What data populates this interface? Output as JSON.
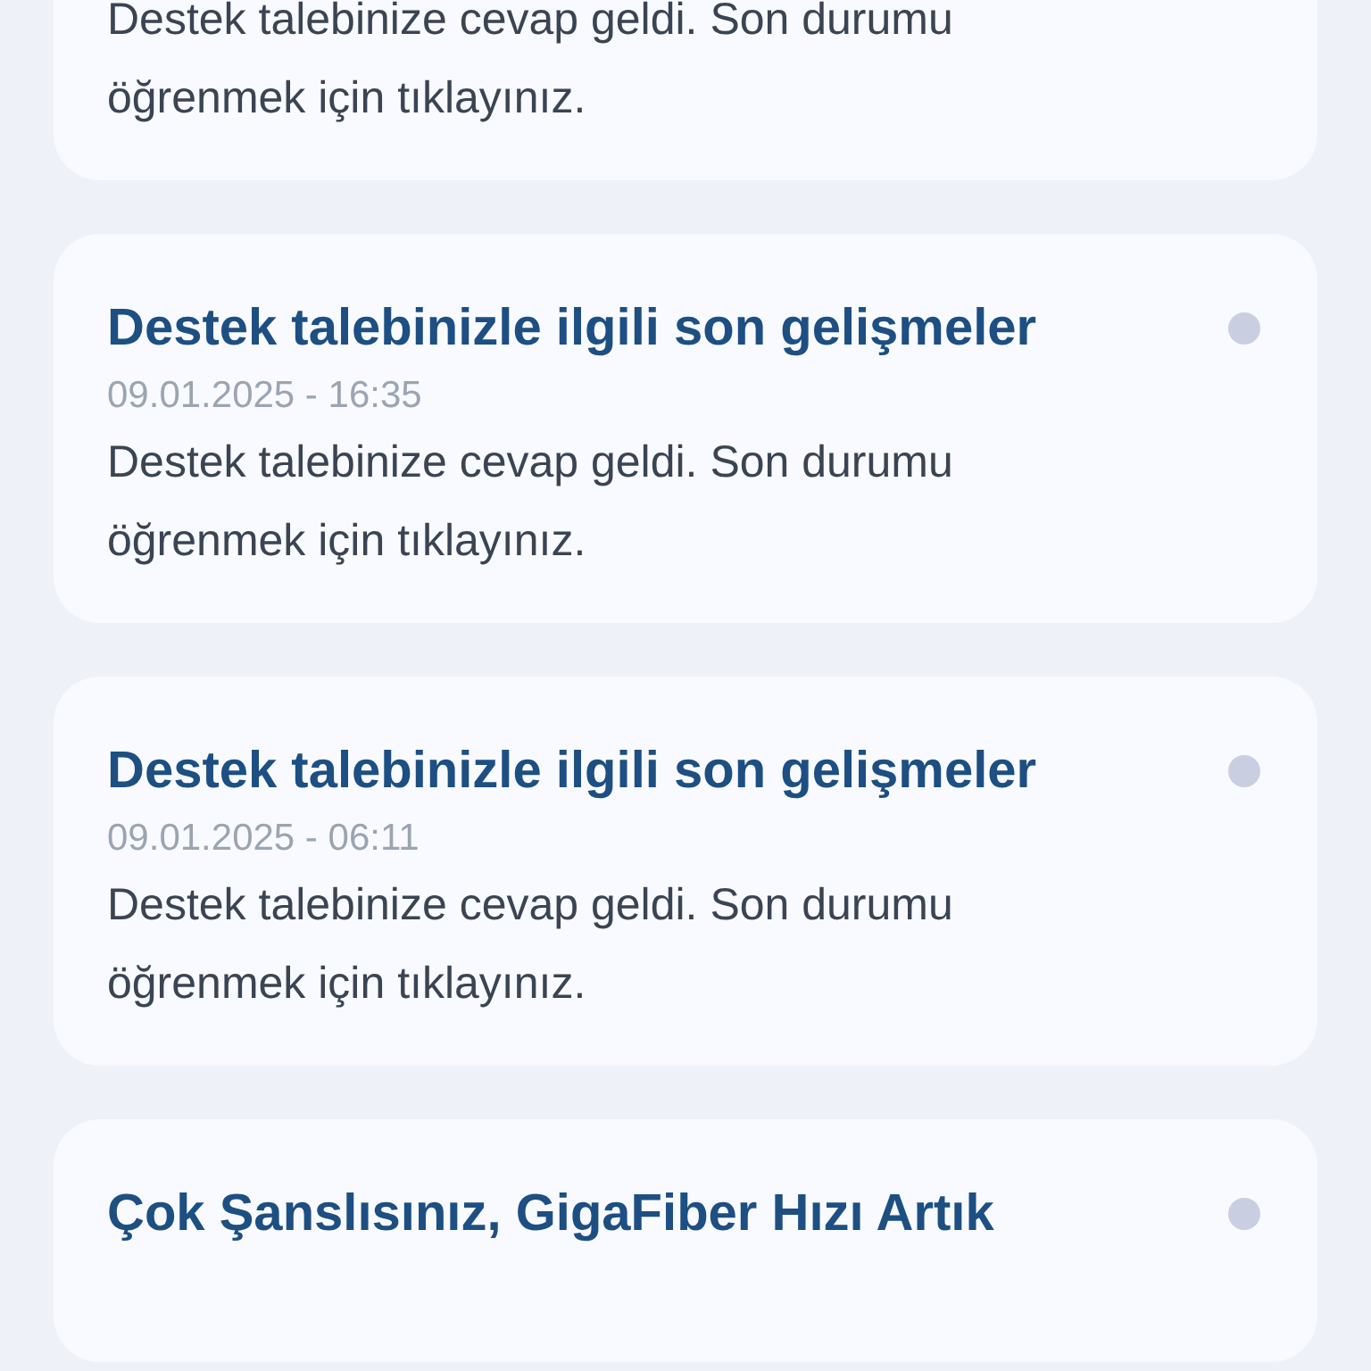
{
  "notifications": [
    {
      "kind": "partial",
      "body": "Destek talebinize cevap geldi. Son durumu öğrenmek için tıklayınız."
    },
    {
      "kind": "full",
      "title": "Destek talebinizle ilgili son gelişmeler",
      "date": "09.01.2025 - 16:35",
      "body": "Destek talebinize cevap geldi. Son durumu öğrenmek için tıklayınız.",
      "unread": true
    },
    {
      "kind": "full",
      "title": "Destek talebinizle ilgili son gelişmeler",
      "date": "09.01.2025 - 06:11",
      "body": "Destek talebinize cevap geldi. Son durumu öğrenmek için tıklayınız.",
      "unread": true
    },
    {
      "kind": "title-only",
      "title": "Çok Şanslısınız, GigaFiber Hızı Artık",
      "unread": true
    }
  ]
}
